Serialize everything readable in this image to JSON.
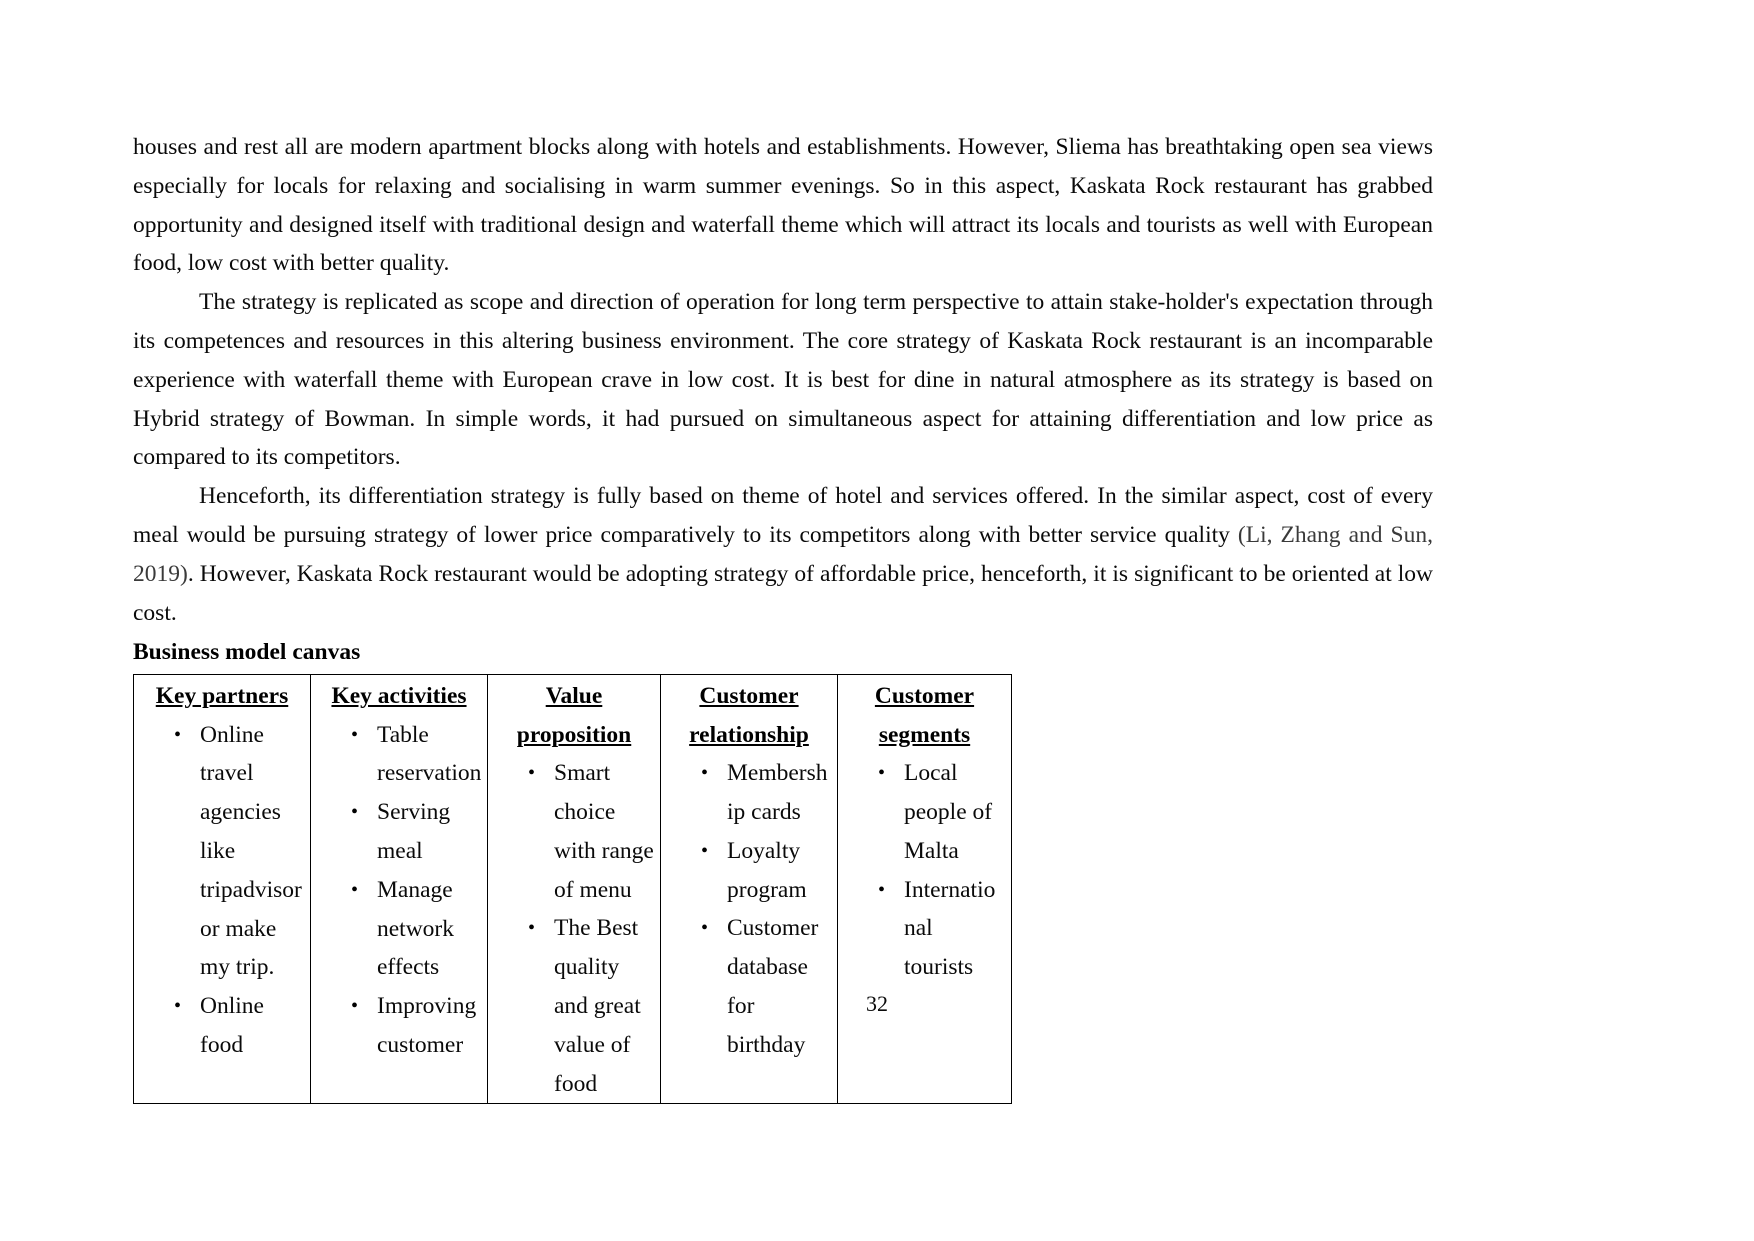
{
  "document": {
    "page_number": "32",
    "paragraphs": [
      {
        "id": "p1",
        "indented": false,
        "text": "houses and rest all are modern apartment blocks along with hotels and establishments. However, Sliema has breathtaking open sea views especially for locals for relaxing and socialising in warm summer evenings. So in this aspect, Kaskata Rock restaurant has grabbed opportunity and designed itself with traditional design and waterfall theme which will attract its locals and tourists as well with European food, low cost with better quality."
      },
      {
        "id": "p2",
        "indented": true,
        "text": "The strategy is replicated as scope and direction of operation for long term perspective to attain stake-holder's expectation through its competences and resources in this altering business environment. The core strategy of Kaskata Rock restaurant is an incomparable experience with waterfall theme with European crave in low cost. It is best for dine in natural atmosphere as its strategy is based on Hybrid strategy of Bowman. In simple words, it had pursued on simultaneous aspect for attaining differentiation and low price as compared to its competitors."
      },
      {
        "id": "p3",
        "indented": true,
        "text_before_citation": "Henceforth, its differentiation strategy is fully based on theme of hotel and services offered. In the similar aspect, cost of every meal would be pursuing strategy of lower price comparatively to its competitors along with better service quality ",
        "citation": "(Li, Zhang and Sun, 2019)",
        "text_after_citation": ". However, Kaskata Rock restaurant would be adopting strategy of affordable price, henceforth, it is significant to be oriented at low cost."
      }
    ],
    "heading": "Business model canvas",
    "table": {
      "columns": [
        {
          "header": "Key partners",
          "items": [
            "Online travel agencies like tripadvisor or make my trip.",
            "Online food"
          ]
        },
        {
          "header": "Key activities",
          "items": [
            "Table reservation",
            "Serving meal",
            "Manage network effects",
            "Improving customer"
          ]
        },
        {
          "header": "Value proposition",
          "items": [
            "Smart choice with range of menu",
            "The Best quality and great value of food"
          ]
        },
        {
          "header": "Customer relationship",
          "items": [
            "Membership cards",
            "Loyalty program",
            "Customer database for birthday"
          ]
        },
        {
          "header": "Customer segments",
          "items": [
            "Local people of Malta",
            "International tourists"
          ]
        }
      ]
    }
  }
}
